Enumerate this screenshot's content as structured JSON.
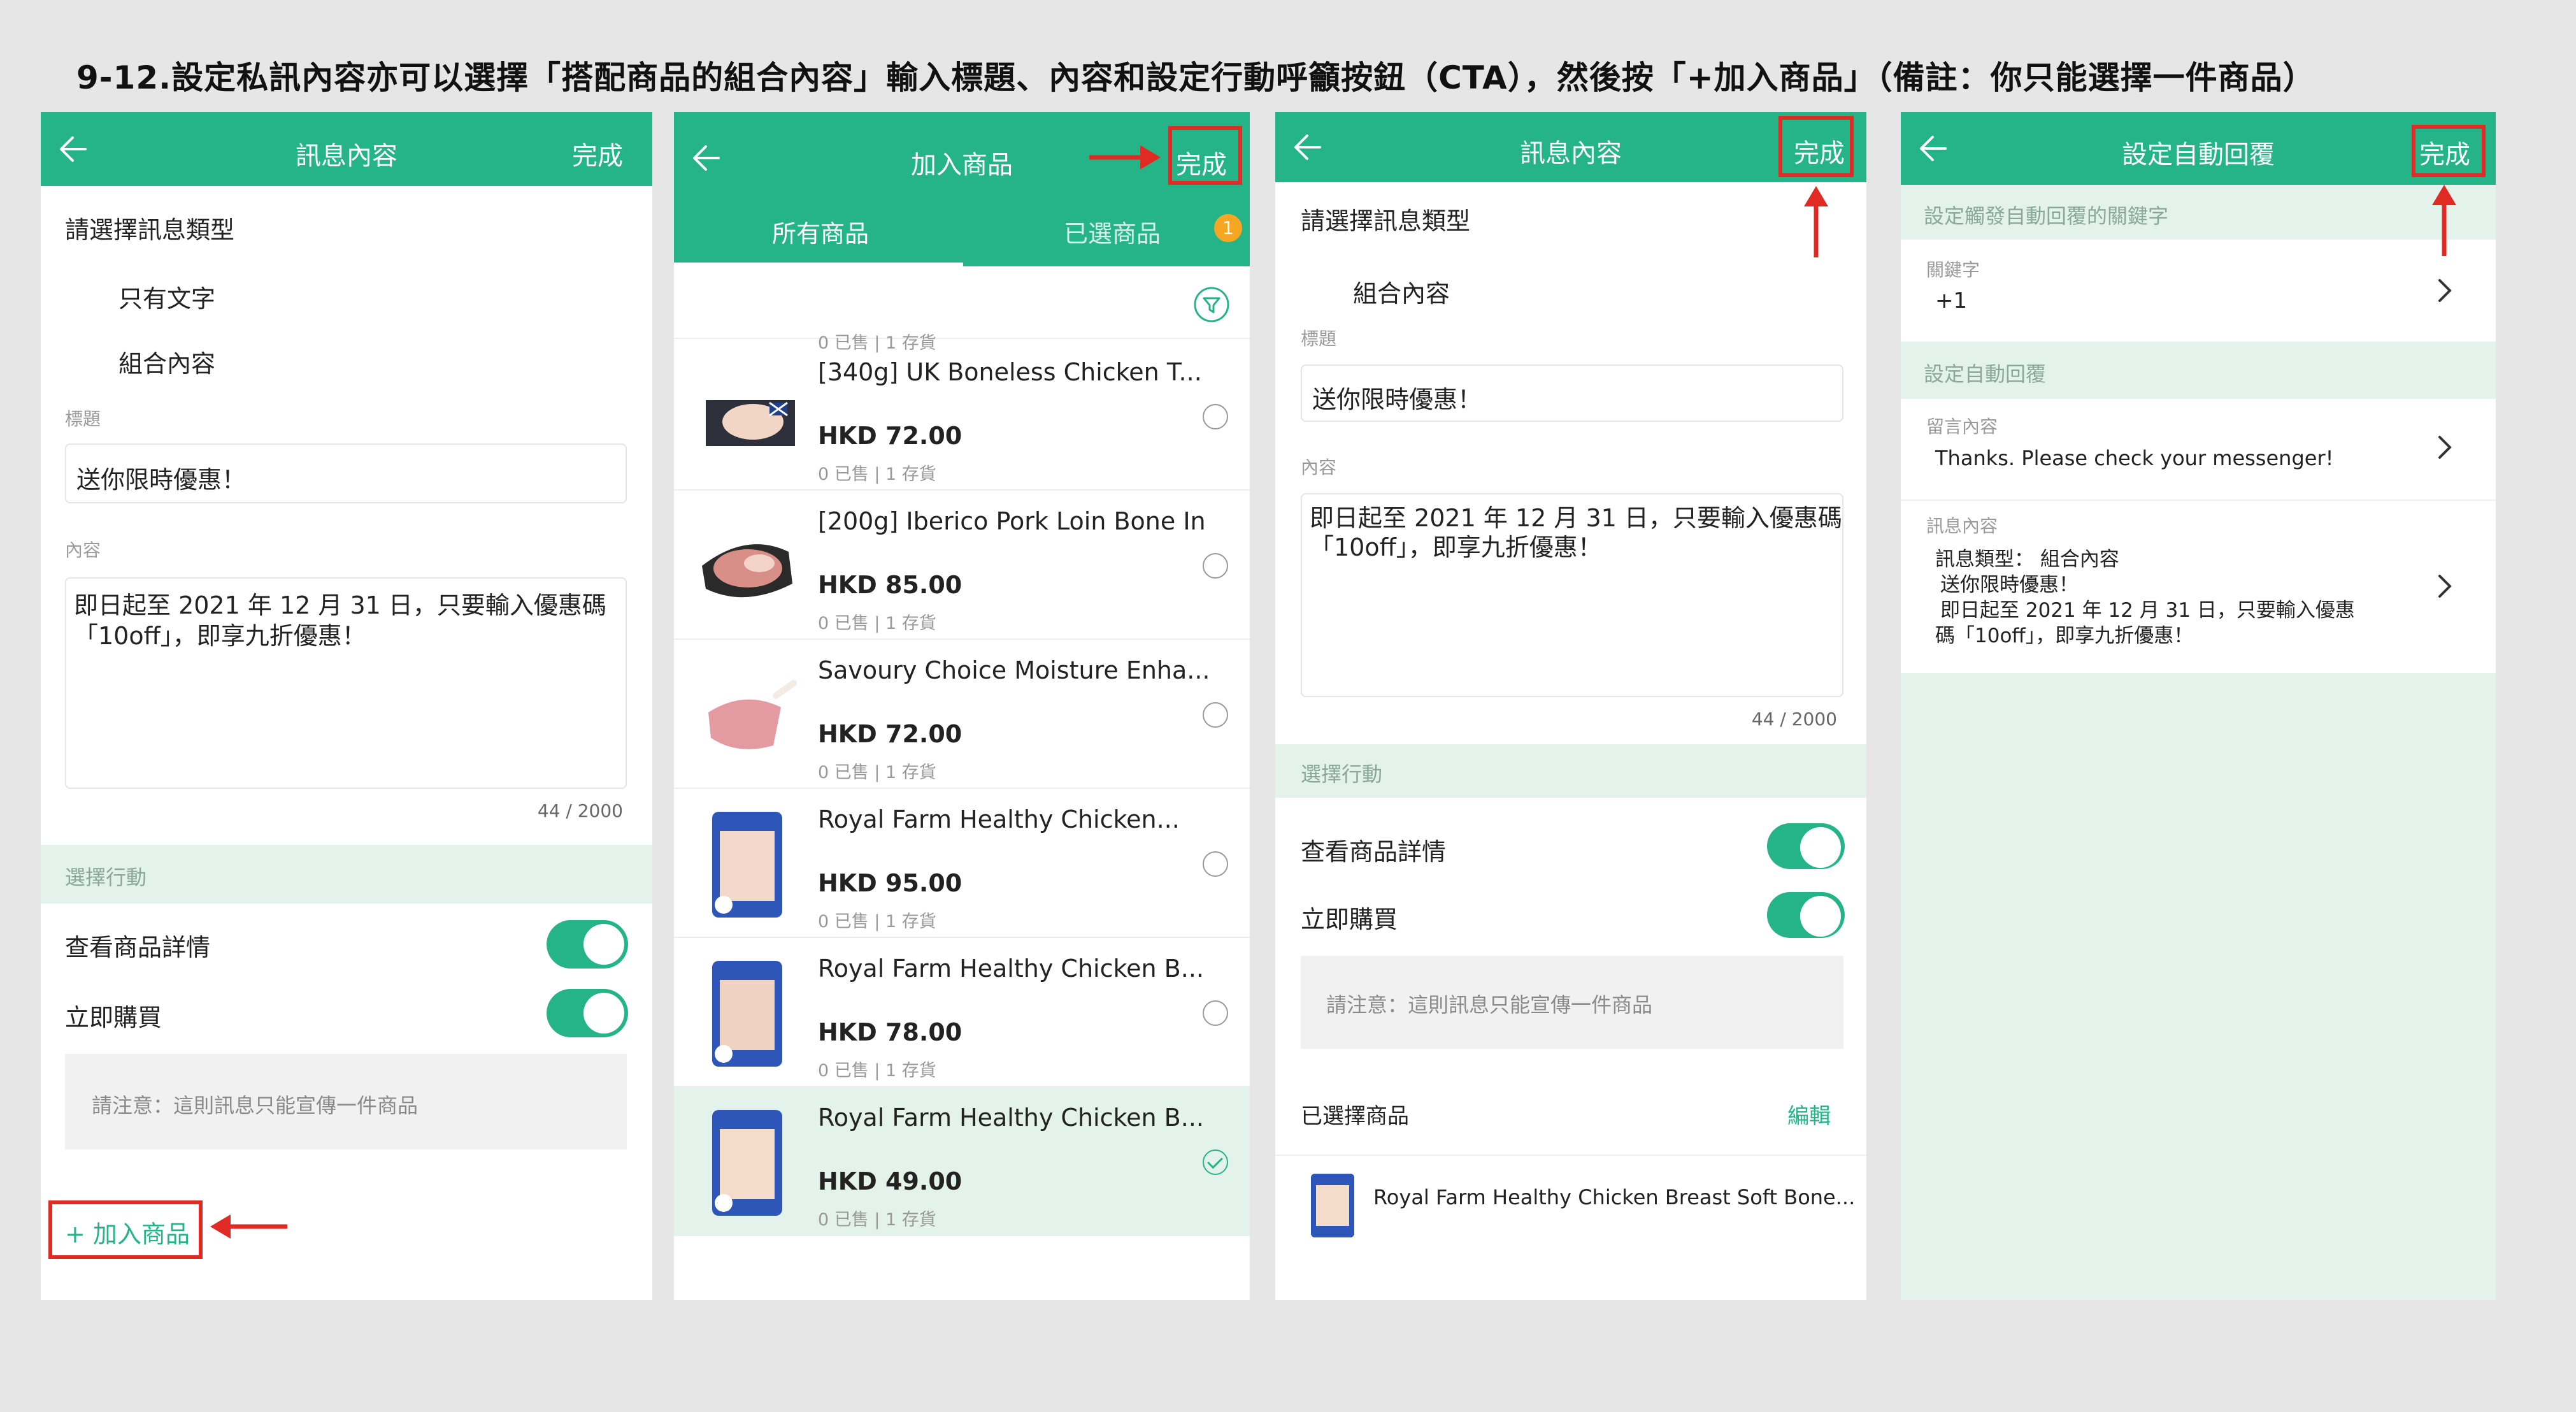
{
  "title": "9-12.設定私訊內容亦可以選擇「搭配商品的組合內容」輸入標題、內容和設定行動呼籲按鈕（CTA），然後按「+加入商品」（備註：你只能選擇一件商品）",
  "colors": {
    "brand": "#25b488",
    "highlight": "#e02a24",
    "section_bg": "#e4f2ec"
  },
  "panel1": {
    "header_title": "訊息內容",
    "done_label": "完成",
    "type_prompt": "請選擇訊息類型",
    "type_options": [
      "只有文字",
      "組合內容"
    ],
    "title_label": "標題",
    "title_value": "送你限時優惠！",
    "content_label": "內容",
    "content_line1": "即日起至 2021 年 12 月 31 日，只要輸入優惠碼",
    "content_line2": "「10off」，即享九折優惠！",
    "char_count": "44 / 2000",
    "action_section": "選擇行動",
    "action_view": "查看商品詳情",
    "action_buy": "立即購買",
    "note": "請注意：這則訊息只能宣傳一件商品",
    "add_product": "+ 加入商品"
  },
  "panel2": {
    "header_title": "加入商品",
    "done_label": "完成",
    "tab_all": "所有商品",
    "tab_selected": "已選商品",
    "selected_count": "1",
    "partial_stock": "0 已售 | 1 存貨",
    "products": [
      {
        "name": "[340g] UK Boneless Chicken T...",
        "price": "HKD 72.00",
        "stock": "0 已售 | 1 存貨",
        "selected": false
      },
      {
        "name": "[200g] Iberico Pork Loin Bone In",
        "price": "HKD 85.00",
        "stock": "0 已售 | 1 存貨",
        "selected": false
      },
      {
        "name": "Savoury Choice Moisture Enha...",
        "price": "HKD 72.00",
        "stock": "0 已售 | 1 存貨",
        "selected": false
      },
      {
        "name": "Royal Farm Healthy Chicken...",
        "price": "HKD 95.00",
        "stock": "0 已售 | 1 存貨",
        "selected": false
      },
      {
        "name": "Royal Farm Healthy Chicken B...",
        "price": "HKD 78.00",
        "stock": "0 已售 | 1 存貨",
        "selected": false
      },
      {
        "name": "Royal Farm Healthy Chicken B...",
        "price": "HKD 49.00",
        "stock": "0 已售 | 1 存貨",
        "selected": true
      }
    ]
  },
  "panel3": {
    "header_title": "訊息內容",
    "done_label": "完成",
    "type_prompt": "請選擇訊息類型",
    "type_option": "組合內容",
    "title_label": "標題",
    "title_value": "送你限時優惠！",
    "content_label": "內容",
    "content_line1": "即日起至 2021 年 12 月 31 日，只要輸入優惠碼",
    "content_line2": "「10off」，即享九折優惠！",
    "char_count": "44 / 2000",
    "action_section": "選擇行動",
    "action_view": "查看商品詳情",
    "action_buy": "立即購買",
    "note": "請注意：這則訊息只能宣傳一件商品",
    "selected_label": "已選擇商品",
    "edit_label": "編輯",
    "selected_product": "Royal Farm Healthy Chicken Breast Soft Bone..."
  },
  "panel4": {
    "header_title": "設定自動回覆",
    "done_label": "完成",
    "keyword_section": "設定觸發自動回覆的關鍵字",
    "keyword_label": "關鍵字",
    "keyword_value": "+1",
    "reply_section": "設定自動回覆",
    "comment_label": "留言內容",
    "comment_value": "Thanks. Please check your messenger!",
    "message_label": "訊息內容",
    "message_line1": "訊息類型： 組合內容",
    "message_line2": "送你限時優惠！",
    "message_line3": "即日起至 2021 年 12 月 31 日，只要輸入優惠",
    "message_line4": "碼「10off」，即享九折優惠！"
  }
}
